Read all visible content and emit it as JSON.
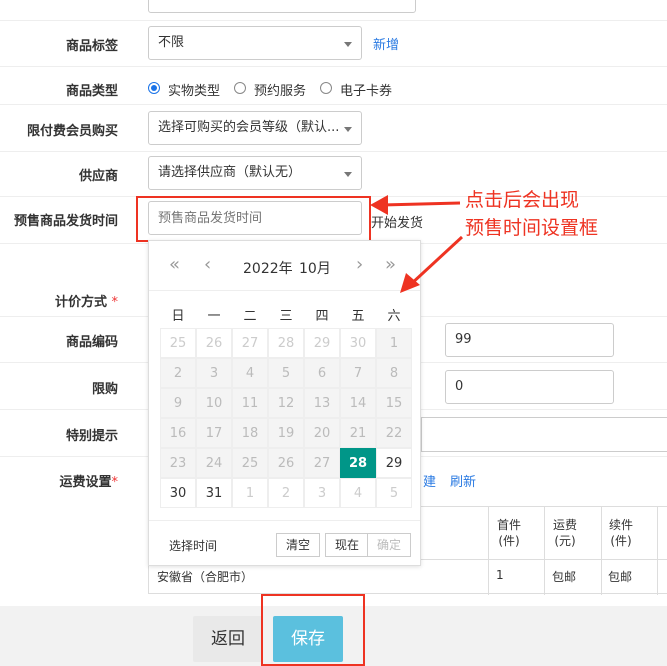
{
  "form": {
    "tag": {
      "label": "商品标签",
      "value": "不限",
      "add_link": "新增"
    },
    "type": {
      "label": "商品类型",
      "options": [
        "实物类型",
        "预约服务",
        "电子卡券"
      ]
    },
    "member": {
      "label": "限付费会员购买",
      "value": "选择可购买的会员等级（默认..."
    },
    "supplier": {
      "label": "供应商",
      "value": "请选择供应商（默认无）"
    },
    "presale": {
      "label": "预售商品发货时间",
      "placeholder": "预售商品发货时间",
      "suffix": "开始发货"
    },
    "pricing": {
      "label": "计价方式",
      "required_mark": "*"
    },
    "code": {
      "label": "商品编码",
      "value": "99"
    },
    "limit": {
      "label": "限购",
      "value": "0"
    },
    "tips": {
      "label": "特别提示"
    },
    "shipping": {
      "label": "运费设置",
      "required_mark": "*",
      "link_new_suffix": "建",
      "link_refresh": "刷新"
    }
  },
  "calendar": {
    "nav": {
      "prev_year": "«",
      "prev_month": "‹",
      "next_month": "›",
      "next_year": "»"
    },
    "year": "2022年",
    "month": "10月",
    "weekdays": [
      "日",
      "一",
      "二",
      "三",
      "四",
      "五",
      "六"
    ],
    "days": [
      [
        "25",
        "26",
        "27",
        "28",
        "29",
        "30",
        "1"
      ],
      [
        "2",
        "3",
        "4",
        "5",
        "6",
        "7",
        "8"
      ],
      [
        "9",
        "10",
        "11",
        "12",
        "13",
        "14",
        "15"
      ],
      [
        "16",
        "17",
        "18",
        "19",
        "20",
        "21",
        "22"
      ],
      [
        "23",
        "24",
        "25",
        "26",
        "27",
        "28",
        "29"
      ],
      [
        "30",
        "31",
        "1",
        "2",
        "3",
        "4",
        "5"
      ]
    ],
    "selected": "28",
    "footer": {
      "pick_time": "选择时间",
      "clear": "清空",
      "now": "现在",
      "confirm": "确定"
    }
  },
  "annotation": {
    "line1": "点击后会出现",
    "line2": "预售时间设置框",
    "color": "#e32222"
  },
  "shipping_table": {
    "headers": [
      "首件\n(件)",
      "运费\n(元)",
      "续件\n(件)"
    ],
    "row": {
      "region": "安徽省（合肥市）",
      "first": "1",
      "fee": "包邮",
      "next": "包邮"
    }
  },
  "buttons": {
    "back": "返回",
    "save": "保存"
  }
}
